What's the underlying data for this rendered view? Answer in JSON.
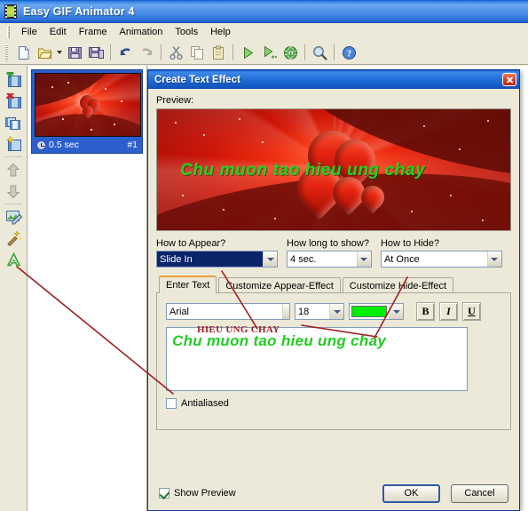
{
  "window": {
    "title": "Easy GIF Animator 4",
    "app_icon": "film-strip-icon"
  },
  "menu": {
    "items": [
      {
        "label": "File"
      },
      {
        "label": "Edit"
      },
      {
        "label": "Frame"
      },
      {
        "label": "Animation"
      },
      {
        "label": "Tools"
      },
      {
        "label": "Help"
      }
    ]
  },
  "toolbar": {
    "buttons": [
      {
        "name": "new-icon",
        "title": "New"
      },
      {
        "name": "open-icon",
        "title": "Open"
      },
      {
        "name": "open-dropdown-icon",
        "title": "Open recent"
      },
      {
        "name": "save-icon",
        "title": "Save"
      },
      {
        "name": "save-as-icon",
        "title": "Save As"
      },
      {
        "name": "undo-icon",
        "title": "Undo"
      },
      {
        "name": "redo-icon",
        "title": "Redo"
      },
      {
        "name": "cut-icon",
        "title": "Cut"
      },
      {
        "name": "copy-icon",
        "title": "Copy"
      },
      {
        "name": "paste-icon",
        "title": "Paste"
      },
      {
        "name": "play-icon",
        "title": "Play"
      },
      {
        "name": "play-options-icon",
        "title": "Play options"
      },
      {
        "name": "preview-browser-icon",
        "title": "Preview in browser"
      },
      {
        "name": "zoom-icon",
        "title": "Zoom"
      },
      {
        "name": "help-icon",
        "title": "Help"
      }
    ]
  },
  "side_tools": {
    "buttons": [
      {
        "name": "add-frame-icon",
        "title": "Add frame"
      },
      {
        "name": "delete-frame-icon",
        "title": "Delete frame"
      },
      {
        "name": "duplicate-frame-icon",
        "title": "Duplicate frame"
      },
      {
        "name": "frame-effect-icon",
        "title": "Frame effect"
      },
      {
        "name": "move-frame-up-icon",
        "title": "Move frame up"
      },
      {
        "name": "move-frame-down-icon",
        "title": "Move frame down"
      },
      {
        "name": "edit-image-icon",
        "title": "Edit image"
      },
      {
        "name": "magic-wand-icon",
        "title": "Magic wand"
      },
      {
        "name": "add-text-icon",
        "title": "Add text effect"
      }
    ]
  },
  "frames": {
    "items": [
      {
        "duration": "0.5 sec",
        "index_label": "#1",
        "selected": true
      }
    ]
  },
  "dialog": {
    "title": "Create Text Effect",
    "close_icon": "close-icon",
    "preview_label": "Preview:",
    "preview_text": "Chu muon tao hieu ung chay",
    "controls": {
      "how_to_appear": {
        "label": "How to Appear?",
        "value": "Slide In",
        "selected": true
      },
      "how_long_to_show": {
        "label": "How long to show?",
        "value": "4 sec."
      },
      "how_to_hide": {
        "label": "How to Hide?",
        "value": "At Once"
      }
    },
    "tabs": [
      {
        "label": "Enter Text",
        "active": true
      },
      {
        "label": "Customize Appear-Effect",
        "active": false
      },
      {
        "label": "Customize Hide-Effect",
        "active": false
      }
    ],
    "enter_text": {
      "font_family": "Arial",
      "font_size": "18",
      "color_hex": "#00EE00",
      "bold_label": "B",
      "italic_label": "I",
      "underline_label": "U",
      "text_value": "Chu muon tao hieu ung chay",
      "antialiased": {
        "label": "Antialiased",
        "checked": false
      }
    },
    "footer": {
      "show_preview": {
        "label": "Show Preview",
        "checked": true
      },
      "ok_label": "OK",
      "cancel_label": "Cancel"
    }
  },
  "annotations": {
    "note_text": "HIEU UNG CHAY",
    "color_hex": "#A32020"
  }
}
